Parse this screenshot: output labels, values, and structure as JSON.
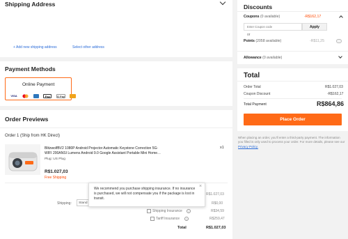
{
  "shipping": {
    "title": "Shipping Address",
    "add_link": "+ Add new shipping address",
    "select_link": "Select other address"
  },
  "payment": {
    "title": "Payment Methods",
    "online_label": "Online Payment",
    "card_icons": [
      "VISA",
      "mastercard",
      "Pay",
      "G Pay",
      "card"
    ]
  },
  "order": {
    "title": "Order Previews",
    "subtitle": "Order 1 (Ship from HK Direct)",
    "product_name_line1": "BlitzwolfBV2 1080P Android Projector Automatic Keystone Correction 5G-",
    "product_name_line2": "WIFI 200ANSI Lumens Android 9.0 Google Assistant Portable Mini Home…",
    "plug_label": "Plug:",
    "plug_value": "US Plug",
    "qty": "x1",
    "price": "R$1.027,03",
    "shipping_note": "Free Shipping",
    "subtotal_value": "R$1.027,03",
    "shipping_label": "Shipping:",
    "shipping_select": "Stand",
    "shipping_value": "R$0,00",
    "insurance_label": "Shipping Insurance",
    "insurance_value": "R$34,59",
    "tariff_label": "Tariff Insurance",
    "tariff_value": "R$259,47",
    "total_label": "Total",
    "total_value": "R$1.027,03"
  },
  "tooltip": {
    "text": "We recommend you purchase shipping insurance. If no insurance is purchased, we will not compensate you if the package is lost in transit."
  },
  "discounts": {
    "title": "Discounts",
    "coupons_label": "Coupons",
    "coupons_available": "(0 available)",
    "coupons_value": "-R$162,17",
    "coupon_placeholder": "Enter Coupon code",
    "apply_label": "Apply",
    "or_label": "or",
    "points_label": "Points",
    "points_available": "(2058 available)",
    "points_value": "-R$11,25",
    "allowance_label": "Allowance",
    "allowance_available": "(0 available)"
  },
  "total": {
    "title": "Total",
    "order_total_label": "Order Total",
    "order_total_value": "R$1.027,03",
    "coupon_discount_label": "Coupon Discount",
    "coupon_discount_value": "-R$162,17",
    "total_payment_label": "Total Payment",
    "total_payment_value": "R$864,86",
    "place_order_label": "Place Order"
  },
  "disclaimer": {
    "text": "When placing an order, you'll enter a third-party payment. The information you filled is only used to process your order. For more details, please see our",
    "link": "Privacy Policy."
  },
  "colors": {
    "accent": "#ff6a17",
    "brand_orange": "#ff4800",
    "link": "#2a6bd8"
  }
}
